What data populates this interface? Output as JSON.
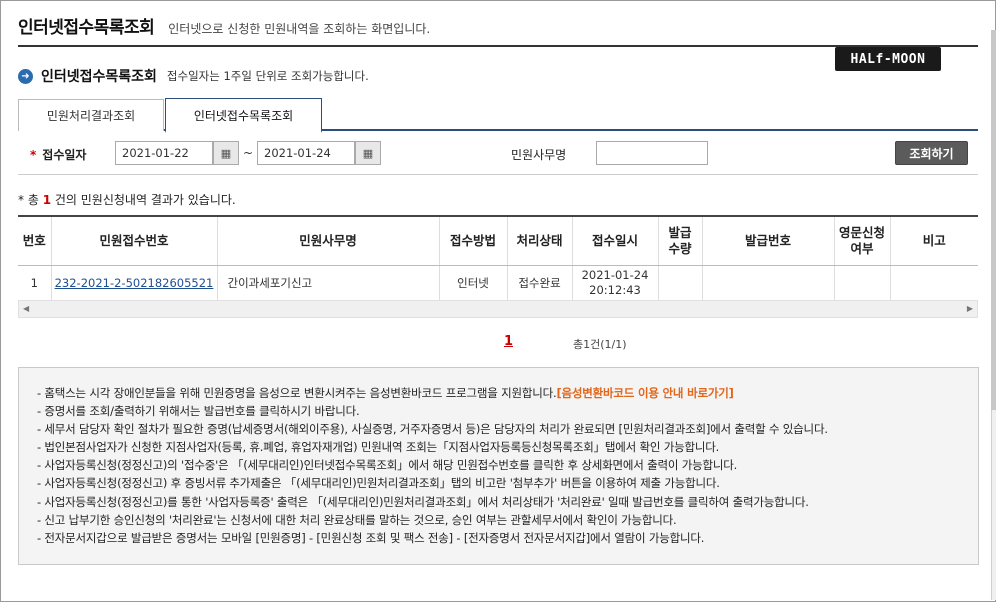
{
  "header": {
    "title": "인터넷접수목록조회",
    "subtitle": "인터넷으로 신청한 민원내역을 조회하는 화면입니다."
  },
  "logo": {
    "text": "HALf-MOON"
  },
  "section": {
    "title": "인터넷접수목록조회",
    "note": "접수일자는 1주일 단위로 조회가능합니다."
  },
  "tabs": [
    {
      "label": "민원처리결과조회",
      "active": false
    },
    {
      "label": "인터넷접수목록조회",
      "active": true
    }
  ],
  "search": {
    "required_mark": "*",
    "date_label": "접수일자",
    "date_from": "2021-01-22",
    "date_to": "2021-01-24",
    "tilde": "~",
    "affair_label": "민원사무명",
    "affair_value": "",
    "button": "조회하기"
  },
  "result": {
    "prefix": "* 총",
    "count": "1",
    "suffix": "건의 민원신청내역 결과가 있습니다."
  },
  "table": {
    "columns": [
      "번호",
      "민원접수번호",
      "민원사무명",
      "접수방법",
      "처리상태",
      "접수일시",
      "발급\n수량",
      "발급번호",
      "영문신청\n여부",
      "비고"
    ],
    "rows": [
      {
        "no": "1",
        "receipt_no": "232-2021-2-502182605521",
        "affair": "간이과세포기신고",
        "method": "인터넷",
        "status": "접수완료",
        "datetime_date": "2021-01-24",
        "datetime_time": "20:12:43",
        "issue_qty": "",
        "issue_no": "",
        "english": "",
        "remark": ""
      }
    ]
  },
  "pager": {
    "current": "1",
    "total": "총1건(1/1)"
  },
  "notice": {
    "items": [
      "- 홈택스는 시각 장애인분들을 위해 민원증명을 음성으로 변환시켜주는 음성변환바코드 프로그램을 지원합니다.",
      "- 증명서를 조회/출력하기 위해서는 발급번호를 클릭하시기 바랍니다.",
      "- 세무서 담당자 확인 절차가 필요한 증명(납세증명서(해외이주용), 사실증명, 거주자증명서 등)은 담당자의 처리가 완료되면 [민원처리결과조회]에서 출력할 수 있습니다.",
      "- 법인본점사업자가 신청한 지점사업자(등록, 휴.폐업, 휴업자재개업) 민원내역 조회는「지점사업자등록등신청목록조회」탭에서 확인 가능합니다.",
      "- 사업자등록신청(정정신고)의 '접수중'은 「(세무대리인)인터넷접수목록조회」에서 해당 민원접수번호를 클릭한 후 상세화면에서 출력이 가능합니다.",
      "- 사업자등록신청(정정신고) 후 증빙서류 추가제출은 「(세무대리인)민원처리결과조회」탭의 비고란 '첨부추가' 버튼을 이용하여 제출 가능합니다.",
      "- 사업자등록신청(정정신고)를 통한 '사업자등록증' 출력은  「(세무대리인)민원처리결과조회」에서 처리상태가 '처리완료' 일때 발급번호를 클릭하여 출력가능합니다.",
      "- 신고 납부기한 승인신청의 '처리완료'는 신청서에 대한 처리 완료상태를 말하는 것으로, 승인 여부는 관할세무서에서 확인이 가능합니다.",
      "- 전자문서지갑으로 발급받은 증명서는 모바일 [민원증명] - [민원신청 조회 및 팩스 전송] - [전자증명서 전자문서지갑]에서 열람이 가능합니다."
    ],
    "link": "[음성변환바코드 이용 안내 바로가기]"
  },
  "colors": {
    "accent_blue": "#2b6cb0",
    "tab_border": "#2b4f7a",
    "highlight": "#e2661a",
    "count_red": "#cc0000"
  },
  "icons": {
    "section_bullet": "arrow-circle-icon",
    "calendar": "calendar-icon"
  }
}
